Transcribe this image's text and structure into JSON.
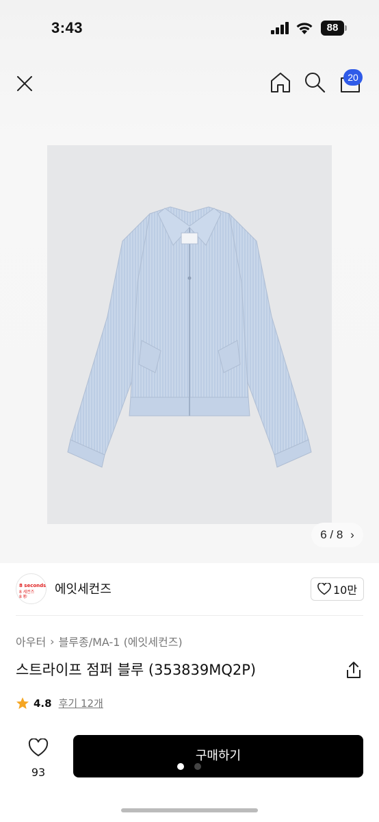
{
  "status_bar": {
    "time": "3:43",
    "battery": "88"
  },
  "nav": {
    "cart_count": "20"
  },
  "gallery": {
    "counter": "6 / 8",
    "current": 6,
    "total": 8,
    "image_background": "#e6e7e9"
  },
  "brand": {
    "name": "에잇세컨즈",
    "logo_line1": "8 seconds",
    "logo_line2": "8 세컨즈",
    "logo_line3": "8 秒",
    "logo_color": "#e02020",
    "like_count": "10만"
  },
  "breadcrumb": {
    "category": "아우터",
    "subcategory": "블루종/MA-1 (에잇세컨즈)"
  },
  "product": {
    "title": "스트라이프 점퍼 블루 (353839MQ2P)",
    "rating": "4.8",
    "reviews": "후기 12개",
    "star_color": "#f5a623"
  },
  "bottom_bar": {
    "wish_count": "93",
    "buy_label": "구매하기",
    "buy_color": "#000000"
  },
  "accent": {
    "badge_color": "#2f5be8"
  }
}
